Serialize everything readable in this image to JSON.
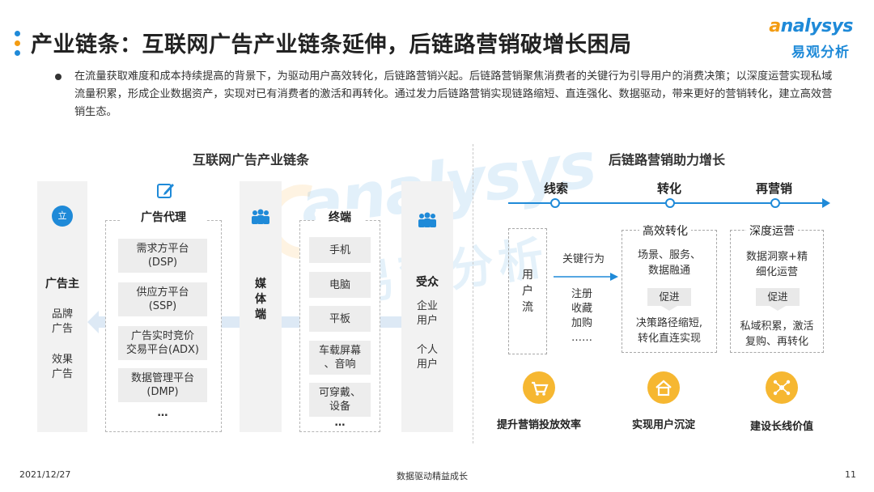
{
  "header": {
    "title": "产业链条：互联网广告产业链条延伸，后链路营销破增长困局",
    "logo_en_accent": "a",
    "logo_en_rest": "nalysys",
    "logo_cn": "易观分析"
  },
  "bullet": "在流量获取难度和成本持续提高的背景下，为驱动用户高效转化，后链路营销兴起。后链路营销聚焦消费者的关键行为引导用户的消费决策；以深度运营实现私域流量积累，形成企业数据资产，实现对已有消费者的激活和再转化。通过发力后链路营销实现链路缩短、直连强化、数据驱动，带来更好的营销转化，建立高效营销生态。",
  "watermark": {
    "en": "analysys",
    "cn": "易观分析"
  },
  "left": {
    "title": "互联网广告产业链条",
    "advertiser": {
      "label": "广告主",
      "items": [
        "品牌\n广告",
        "效果\n广告"
      ]
    },
    "agency": {
      "label": "广告代理",
      "items": [
        "需求方平台\n(DSP)",
        "供应方平台\n(SSP)",
        "广告实时竞价\n交易平台(ADX)",
        "数据管理平台\n(DMP)"
      ],
      "more": "…"
    },
    "media": {
      "label": "媒\n体\n端"
    },
    "terminal": {
      "label": "终端",
      "items": [
        "手机",
        "电脑",
        "平板",
        "车载屏幕\n、音响",
        "可穿戴、\n设备"
      ],
      "more": "…"
    },
    "audience": {
      "label": "受众",
      "items": [
        "企业\n用户",
        "个人\n用户"
      ]
    }
  },
  "right": {
    "title": "后链路营销助力增长",
    "timeline": [
      "线索",
      "转化",
      "再营销"
    ],
    "user_flow": "用\n户\n流",
    "key_behavior": "关键行为",
    "behaviors": "注册\n收藏\n加购\n……",
    "stages": [
      {
        "title": "高效转化",
        "top": "场景、服务、\n数据融通",
        "promote": "促进",
        "bottom": "决策路径缩短,\n转化直连实现"
      },
      {
        "title": "深度运营",
        "top": "数据洞察+精\n细化运营",
        "promote": "促进",
        "bottom": "私域积累，激活\n复购、再转化"
      }
    ],
    "outcomes": [
      "提升营销投放效率",
      "实现用户沉淀",
      "建设长线价值"
    ]
  },
  "footer": {
    "date": "2021/12/27",
    "center": "数据驱动精益成长",
    "page": "11"
  },
  "colors": {
    "primary": "#1f8ad8",
    "accent": "#f39c12",
    "icon_yellow": "#f6b731",
    "panel": "#f2f2f2"
  }
}
